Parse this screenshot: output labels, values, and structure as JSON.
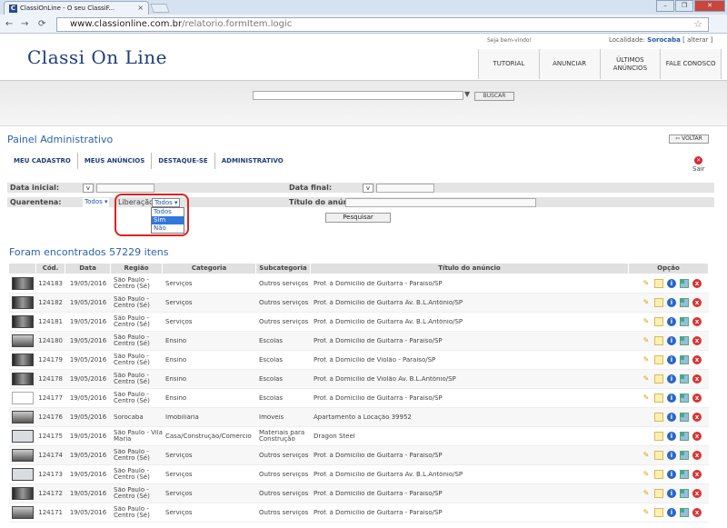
{
  "browser": {
    "tab_title": "ClassiOnLine - O seu ClassiF...",
    "tab_close": "×",
    "favicon": "C",
    "url_host": "www.classionline.com.br",
    "url_path": "/relatorio.formItem.logic",
    "win_min": "–",
    "win_max": "❐",
    "win_close": "✕",
    "back": "←",
    "forward": "→",
    "star": "☆",
    "wrench": "🔧"
  },
  "header": {
    "logo": "Classi On Line",
    "welcome": "Seja bem-vindo!",
    "location_label": "Localidade:",
    "location": "Sorocaba",
    "alterar": "[ alterar ]",
    "nav": [
      "TUTORIAL",
      "ANUNCIAR",
      "ÚLTIMOS ANÚNCIOS",
      "FALE CONOSCO"
    ]
  },
  "search": {
    "button": "BUSCAR",
    "arrow": "▼"
  },
  "panel": {
    "title": "Painel Administrativo",
    "voltar": "VOLTAR",
    "menu": [
      "MEU CADASTRO",
      "MEUS ANÚNCIOS",
      "DESTAQUE-SE",
      "ADMINISTRATIVO"
    ],
    "sair": "Sair",
    "sair_icon": "✕"
  },
  "filters": {
    "data_inicial": "Data inicial:",
    "data_final": "Data final:",
    "quarentena": "Quarentena:",
    "quarentena_value": "Todos ▾",
    "liberacao": "Liberação",
    "liberacao_value": "Todos ▾",
    "titulo": "Título do anúncio:",
    "date_btn": "v",
    "options": [
      "Todos",
      "Sim",
      "Não"
    ],
    "pesquisar": "Pesquisar"
  },
  "results": {
    "found": "Foram encontrados 57229 itens",
    "headers": [
      "Cód.",
      "Data",
      "Região",
      "Categoria",
      "Subcategoria",
      "Título do anúncio",
      "Opção"
    ],
    "rows": [
      {
        "cod": "124183",
        "data": "19/05/2016",
        "regiao": "São Paulo - Centro (Sé)",
        "categoria": "Serviços",
        "sub": "Outros serviços",
        "titulo": "Prof. à Domicílio de Guitarra - Paraíso/SP"
      },
      {
        "cod": "124182",
        "data": "19/05/2016",
        "regiao": "São Paulo - Centro (Sé)",
        "categoria": "Serviços",
        "sub": "Outros serviços",
        "titulo": "Prof. à Domicílio de Guitarra Av. B.L.Antônio/SP"
      },
      {
        "cod": "124181",
        "data": "19/05/2016",
        "regiao": "São Paulo - Centro (Sé)",
        "categoria": "Serviços",
        "sub": "Outros serviços",
        "titulo": "Prof. à Domicílio de Guitarra Av. B.L.Antônio/SP"
      },
      {
        "cod": "124180",
        "data": "19/05/2016",
        "regiao": "São Paulo - Centro (Sé)",
        "categoria": "Ensino",
        "sub": "Escolas",
        "titulo": "Prof. à Domicílio de Guitarra - Paraíso/SP"
      },
      {
        "cod": "124179",
        "data": "19/05/2016",
        "regiao": "São Paulo - Centro (Sé)",
        "categoria": "Ensino",
        "sub": "Escolas",
        "titulo": "Prof. à Domicílio de Violão - Paraíso/SP"
      },
      {
        "cod": "124178",
        "data": "19/05/2016",
        "regiao": "São Paulo - Centro (Sé)",
        "categoria": "Ensino",
        "sub": "Escolas",
        "titulo": "Prof. à Domicílio de Violão Av. B.L.Antônio/SP"
      },
      {
        "cod": "124177",
        "data": "19/05/2016",
        "regiao": "São Paulo - Centro (Sé)",
        "categoria": "Ensino",
        "sub": "Escolas",
        "titulo": "Prof. à Domicílio de Guitarra - Paraíso/SP"
      },
      {
        "cod": "124176",
        "data": "19/05/2016",
        "regiao": "Sorocaba",
        "categoria": "Imobiliária",
        "sub": "Imóveis",
        "titulo": "Apartamento a Locação 39952"
      },
      {
        "cod": "124175",
        "data": "19/05/2016",
        "regiao": "São Paulo - Vila Maria",
        "categoria": "Casa/Construção/Comércio",
        "sub": "Materiais para Construção",
        "titulo": "Dragon Steel"
      },
      {
        "cod": "124174",
        "data": "19/05/2016",
        "regiao": "São Paulo - Centro (Sé)",
        "categoria": "Serviços",
        "sub": "Outros serviços",
        "titulo": "Prof. à Domicílio de Guitarra - Paraíso/SP"
      },
      {
        "cod": "124173",
        "data": "19/05/2016",
        "regiao": "São Paulo - Centro (Sé)",
        "categoria": "Serviços",
        "sub": "Outros serviços",
        "titulo": "Prof. à Domicílio de Guitarra Av. B.L.Antônio/SP"
      },
      {
        "cod": "124172",
        "data": "19/05/2016",
        "regiao": "São Paulo - Centro (Sé)",
        "categoria": "Serviços",
        "sub": "Outros serviços",
        "titulo": "Prof. à Domicílio de Guitarra - Paraíso/SP"
      },
      {
        "cod": "124171",
        "data": "19/05/2016",
        "regiao": "São Paulo - Centro (Sé)",
        "categoria": "Serviços",
        "sub": "Outros serviços",
        "titulo": "Prof. à Domicílio de Guitarra - Paraíso/SP"
      }
    ]
  },
  "icons": {
    "edit": "✎",
    "info": "i",
    "delete": "x"
  }
}
